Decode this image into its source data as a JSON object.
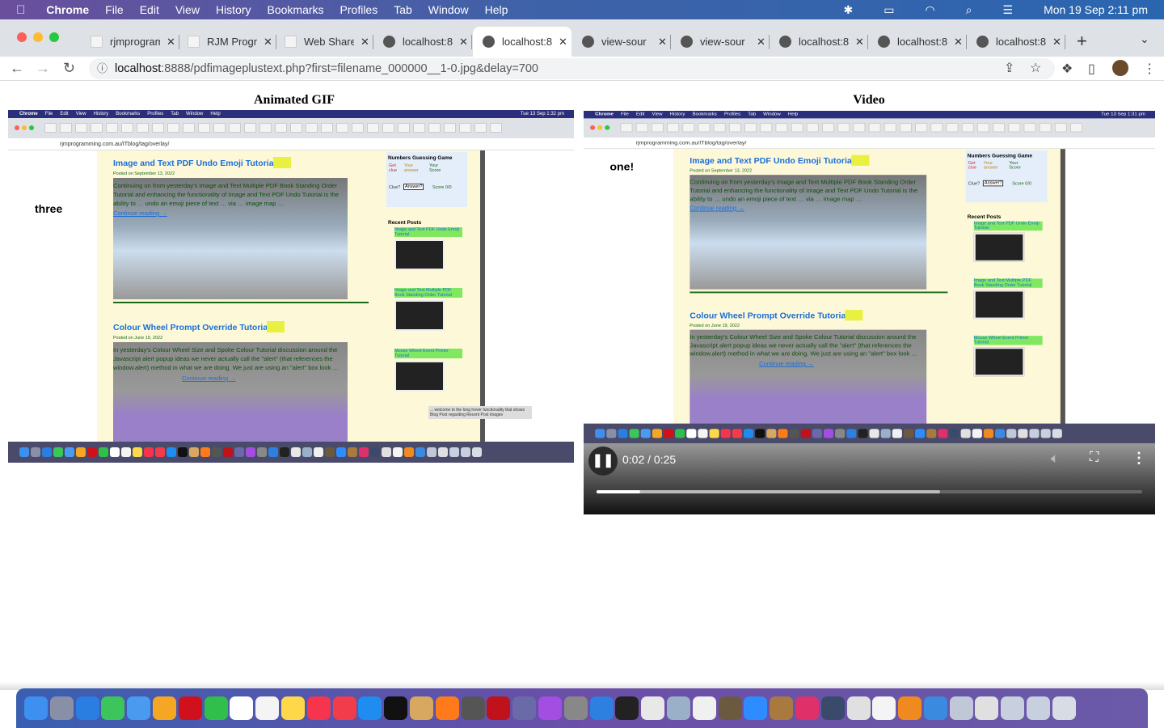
{
  "menubar": {
    "app": "Chrome",
    "items": [
      "File",
      "Edit",
      "View",
      "History",
      "Bookmarks",
      "Profiles",
      "Tab",
      "Window",
      "Help"
    ],
    "clock": "Mon 19 Sep  2:11 pm"
  },
  "tabs": [
    {
      "label": "rjmprogram",
      "active": false
    },
    {
      "label": "RJM Progr",
      "active": false
    },
    {
      "label": "Web Share",
      "active": false
    },
    {
      "label": "localhost:8",
      "active": false
    },
    {
      "label": "localhost:8",
      "active": true
    },
    {
      "label": "view-sour",
      "active": false
    },
    {
      "label": "view-sour",
      "active": false
    },
    {
      "label": "localhost:8",
      "active": false
    },
    {
      "label": "localhost:8",
      "active": false
    },
    {
      "label": "localhost:8",
      "active": false
    }
  ],
  "address": {
    "host": "localhost",
    "rest": ":8888/pdfimageplustext.php?first=filename_000000__1-0.jpg&delay=700"
  },
  "page": {
    "gif_caption": "Animated GIF",
    "video_caption": "Video"
  },
  "gif": {
    "overlay": "three"
  },
  "video": {
    "overlay": "one!",
    "time": "0:02 / 0:25",
    "progress": 0.08,
    "buffered": 0.63
  },
  "inner": {
    "menu": [
      "Chrome",
      "File",
      "Edit",
      "View",
      "History",
      "Bookmarks",
      "Profiles",
      "Tab",
      "Window",
      "Help"
    ],
    "clock_gif": "Tue 13 Sep  1:32 pm",
    "clock_video": "Tue 13 Sep  1:31 pm",
    "url": "rjmprogramming.com.au/ITblog/tag/overlay/",
    "post1": {
      "title": "Image and Text PDF Undo Emoji Tutorial",
      "posted": "Posted on September 13, 2022",
      "author": "admin",
      "excerpt": "Continuing on from yesterday's Image and Text Multiple PDF Book Standing Order Tutorial and enhancing the functionality of Image and Text PDF Undo Tutorial is the ability to … undo an emoji piece of text … via … image map …",
      "more": "Continue reading →"
    },
    "post2": {
      "title": "Colour Wheel Prompt Override Tutorial",
      "posted": "Posted on June 19, 2022",
      "author": "admin",
      "excerpt": "In yesterday's Colour Wheel Size and Spoke Colour Tutorial discussion around the Javascript alert popup ideas we never actually call the \"alert\" (that references the window.alert) method in what we are doing. We just are using an \"alert\" box look …",
      "more": "Continue reading →"
    },
    "sidebar": {
      "game": "Numbers Guessing Game",
      "get_clue": "Get clue",
      "your_answer": "Your answer",
      "your_score": "Your Score",
      "clue": "Clue?",
      "answer": "Answer?",
      "score": "Score 0/0",
      "recent": "Recent Posts",
      "posts": [
        "Image and Text PDF Undo Emoji Tutorial",
        "Image and Text Multiple PDF Book Standing Order Tutorial",
        "Mouse Wheel Event Primer Tutorial"
      ]
    },
    "tooltip": "... welcome to the long hover functionality that shows Blog Post regarding Recent Post images"
  },
  "dock": {
    "icons": [
      {
        "name": "finder",
        "color": "#3d8ff0"
      },
      {
        "name": "launchpad",
        "color": "#8a8fa8"
      },
      {
        "name": "safari",
        "color": "#2a7de1"
      },
      {
        "name": "messages",
        "color": "#3cc55a"
      },
      {
        "name": "mail",
        "color": "#4a9af0"
      },
      {
        "name": "photos",
        "color": "#f5a623"
      },
      {
        "name": "opera",
        "color": "#d0101a"
      },
      {
        "name": "facetime",
        "color": "#2fbf4a"
      },
      {
        "name": "calendar",
        "color": "#ffffff"
      },
      {
        "name": "reminders",
        "color": "#f4f4f4"
      },
      {
        "name": "notes",
        "color": "#ffd84a"
      },
      {
        "name": "music",
        "color": "#f5344e"
      },
      {
        "name": "news",
        "color": "#f23c4c"
      },
      {
        "name": "app-store",
        "color": "#1f8cf0"
      },
      {
        "name": "apple-tv",
        "color": "#111111"
      },
      {
        "name": "game",
        "color": "#d8a860"
      },
      {
        "name": "firefox",
        "color": "#ff7a1a"
      },
      {
        "name": "calculator",
        "color": "#555555"
      },
      {
        "name": "filezilla",
        "color": "#c0121b"
      },
      {
        "name": "bbedit",
        "color": "#6a6aa8"
      },
      {
        "name": "podcasts",
        "color": "#a34ee0"
      },
      {
        "name": "system-preferences",
        "color": "#888888"
      },
      {
        "name": "xcode",
        "color": "#2d7fe0"
      },
      {
        "name": "terminal",
        "color": "#222222"
      },
      {
        "name": "mamp",
        "color": "#e8e8e8"
      },
      {
        "name": "preview",
        "color": "#9ab0c8"
      },
      {
        "name": "textedit",
        "color": "#f0f0f0"
      },
      {
        "name": "gimp",
        "color": "#6b5a40"
      },
      {
        "name": "zoom",
        "color": "#2d8cff"
      },
      {
        "name": "archive",
        "color": "#a87a40"
      },
      {
        "name": "intellij",
        "color": "#e0306a"
      },
      {
        "name": "quicktime",
        "color": "#3a4a6a"
      },
      {
        "name": "chrome",
        "color": "#e0e0e0"
      },
      {
        "name": "document",
        "color": "#f4f4f4"
      },
      {
        "name": "books",
        "color": "#f08a20"
      },
      {
        "name": "mamp-2",
        "color": "#3a8ae0"
      },
      {
        "name": "downloads",
        "color": "#c0c8d8"
      },
      {
        "name": "screenshots",
        "color": "#e0e0e0"
      },
      {
        "name": "screenshots-2",
        "color": "#c8d0e0"
      },
      {
        "name": "screenshots-3",
        "color": "#c8d0e0"
      },
      {
        "name": "trash",
        "color": "#d8dce4"
      }
    ]
  }
}
